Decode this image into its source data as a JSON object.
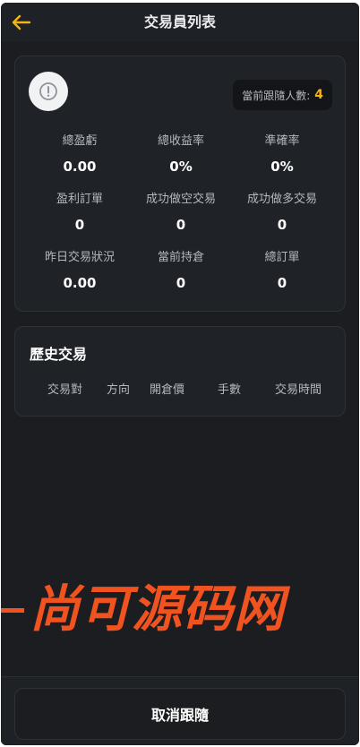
{
  "header": {
    "title": "交易員列表",
    "back_icon": "arrow-left-icon",
    "accent": "#f3b515"
  },
  "summary": {
    "info_icon": "alert-circle-icon",
    "follow_label": "當前跟隨人數:",
    "follow_count": "4",
    "stats": [
      {
        "label": "總盈虧",
        "value": "0.00"
      },
      {
        "label": "總收益率",
        "value": "0%"
      },
      {
        "label": "準確率",
        "value": "0%"
      },
      {
        "label": "盈利訂單",
        "value": "0"
      },
      {
        "label": "成功做空交易",
        "value": "0"
      },
      {
        "label": "成功做多交易",
        "value": "0"
      },
      {
        "label": "昨日交易狀況",
        "value": "0.00"
      },
      {
        "label": "當前持倉",
        "value": "0"
      },
      {
        "label": "總訂單",
        "value": "0"
      }
    ]
  },
  "history": {
    "title": "歷史交易",
    "columns": [
      "交易對",
      "方向",
      "開倉價",
      "手數",
      "交易時間"
    ]
  },
  "watermark": {
    "text": "尚可源码网",
    "color": "#f0531f"
  },
  "footer": {
    "cancel_label": "取消跟隨"
  }
}
